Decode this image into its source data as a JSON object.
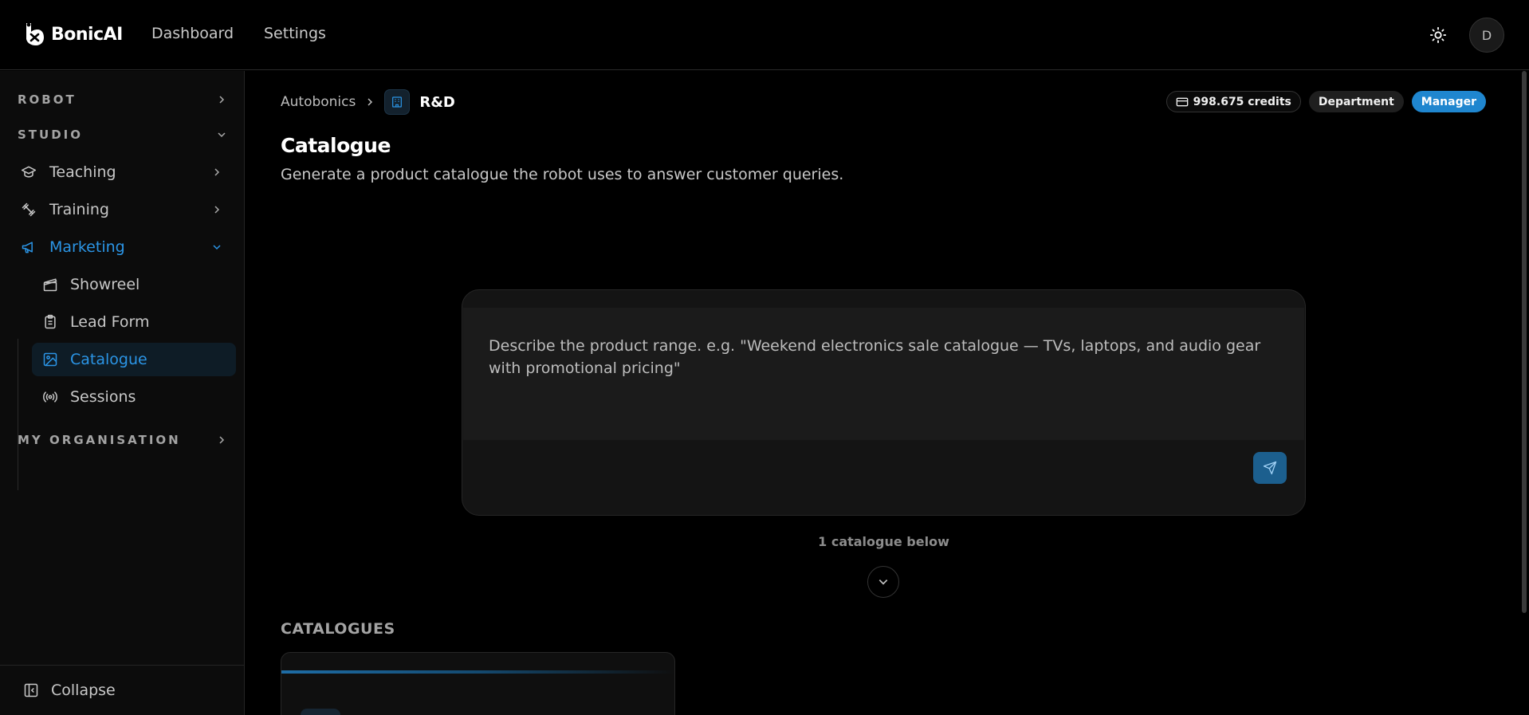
{
  "app": {
    "brand_name": "BonicAI",
    "nav": {
      "dashboard": "Dashboard",
      "settings": "Settings"
    },
    "user_initial": "D"
  },
  "sidebar": {
    "sections": {
      "robot": "ROBOT",
      "studio": "STUDIO",
      "my_org": "MY ORGANISATION"
    },
    "items": [
      {
        "label": "Teaching",
        "icon": "graduation-cap-icon"
      },
      {
        "label": "Training",
        "icon": "dumbbell-icon"
      },
      {
        "label": "Marketing",
        "icon": "megaphone-icon",
        "active": true
      }
    ],
    "sub_items": [
      {
        "label": "Showreel",
        "icon": "clapperboard-icon"
      },
      {
        "label": "Lead Form",
        "icon": "clipboard-icon"
      },
      {
        "label": "Catalogue",
        "icon": "image-icon",
        "active": true
      },
      {
        "label": "Sessions",
        "icon": "radio-broadcast-icon"
      }
    ],
    "collapse_label": "Collapse"
  },
  "breadcrumb": {
    "parent": "Autobonics",
    "current": "R&D"
  },
  "badges": {
    "credits": "998.675 credits",
    "department": "Department",
    "role": "Manager"
  },
  "page": {
    "title": "Catalogue",
    "subtitle": "Generate a product catalogue the robot uses to answer customer queries."
  },
  "composer": {
    "placeholder": "Describe the product range. e.g. \"Weekend electronics sale catalogue — TVs, laptops, and audio gear with promotional pricing\""
  },
  "below_count": "1 catalogue below",
  "catalogues_label": "CATALOGUES",
  "colors": {
    "accent": "#2b95e6",
    "manager_badge": "#1f86cf",
    "send_button": "#1c5f8e"
  }
}
